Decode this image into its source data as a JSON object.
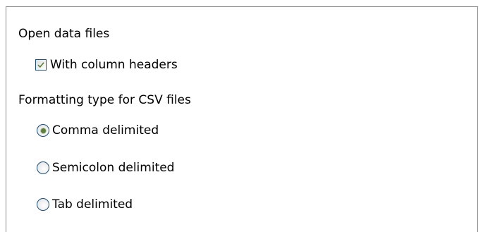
{
  "open_section": {
    "title": "Open data files",
    "with_headers": {
      "label": "With column headers",
      "checked": true
    }
  },
  "csv_section": {
    "title": "Formatting type for CSV files",
    "options": [
      {
        "label": "Comma delimited",
        "selected": true
      },
      {
        "label": "Semicolon delimited",
        "selected": false
      },
      {
        "label": "Tab delimited",
        "selected": false
      }
    ]
  },
  "colors": {
    "control_border": "#1c5180",
    "check_mark": "#5c7f3a",
    "radio_dot": "#5c7f3a",
    "panel_border": "#888888"
  }
}
